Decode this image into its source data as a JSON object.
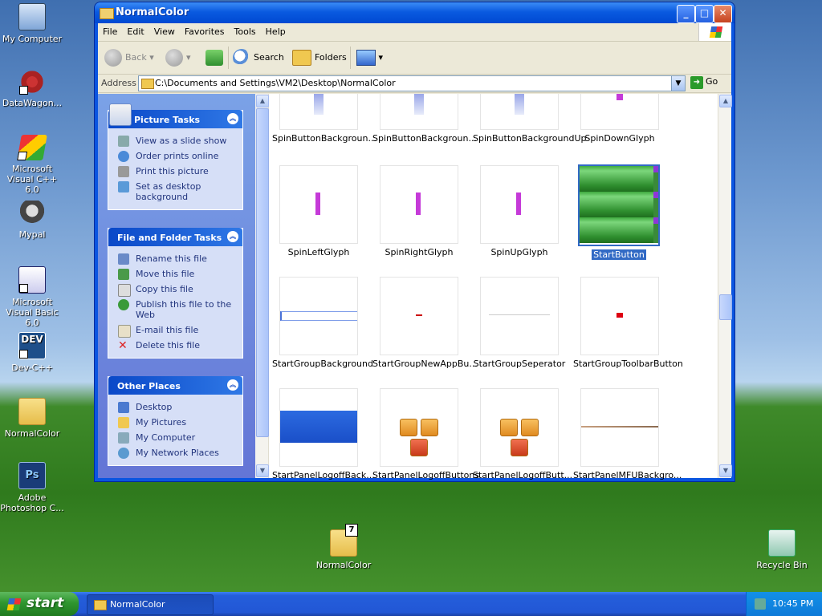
{
  "desktop": {
    "icons": [
      {
        "label": "My Computer",
        "icon": "computer-icon"
      },
      {
        "label": "DataWagon...",
        "icon": "datawagon-icon"
      },
      {
        "label": "Microsoft Visual C++ 6.0",
        "icon": "visual-cpp-icon"
      },
      {
        "label": "Mypal",
        "icon": "mypal-icon"
      },
      {
        "label": "Microsoft Visual Basic 6.0",
        "icon": "visual-basic-icon"
      },
      {
        "label": "Dev-C++",
        "icon": "devcpp-icon"
      },
      {
        "label": "NormalColor",
        "icon": "folder-icon"
      },
      {
        "label": "Adobe Photoshop C...",
        "icon": "photoshop-icon"
      },
      {
        "label": "NormalColor",
        "icon": "folder-icon"
      },
      {
        "label": "Recycle Bin",
        "icon": "recycle-bin-icon"
      }
    ],
    "dev_icon_text": "DEV",
    "ps_icon_text": "Ps",
    "folder7_badge": "7"
  },
  "window": {
    "title": "NormalColor",
    "buttons": {
      "minimize": "_",
      "maximize": "□",
      "close": "✕"
    },
    "menu": [
      "File",
      "Edit",
      "View",
      "Favorites",
      "Tools",
      "Help"
    ],
    "toolbar": {
      "back": "Back",
      "forward": "",
      "search": "Search",
      "folders": "Folders"
    },
    "address": {
      "label": "Address",
      "value": "C:\\Documents and Settings\\VM2\\Desktop\\NormalColor",
      "go": "Go"
    }
  },
  "taskpane": {
    "picture_tasks": {
      "title": "Picture Tasks",
      "items": [
        "View as a slide show",
        "Order prints online",
        "Print this picture",
        "Set as desktop background"
      ]
    },
    "file_tasks": {
      "title": "File and Folder Tasks",
      "items": [
        "Rename this file",
        "Move this file",
        "Copy this file",
        "Publish this file to the Web",
        "E-mail this file",
        "Delete this file"
      ]
    },
    "other_places": {
      "title": "Other Places",
      "items": [
        "Desktop",
        "My Pictures",
        "My Computer",
        "My Network Places"
      ]
    }
  },
  "files": [
    {
      "name": "SpinButtonBackgroun..."
    },
    {
      "name": "SpinButtonBackgroun..."
    },
    {
      "name": "SpinButtonBackgroundUp"
    },
    {
      "name": "SpinDownGlyph"
    },
    {
      "name": "SpinLeftGlyph"
    },
    {
      "name": "SpinRightGlyph"
    },
    {
      "name": "SpinUpGlyph"
    },
    {
      "name": "StartButton",
      "selected": true
    },
    {
      "name": "StartGroupBackground"
    },
    {
      "name": "StartGroupNewAppBu..."
    },
    {
      "name": "StartGroupSeperator"
    },
    {
      "name": "StartGroupToolbarButton"
    },
    {
      "name": "StartPanelLogoffBack..."
    },
    {
      "name": "StartPanelLogoffButtons"
    },
    {
      "name": "StartPanelLogoffButt..."
    },
    {
      "name": "StartPanelMFUBackgro..."
    }
  ],
  "taskbar": {
    "start": "start",
    "task": "NormalColor",
    "clock": "10:45 PM"
  }
}
